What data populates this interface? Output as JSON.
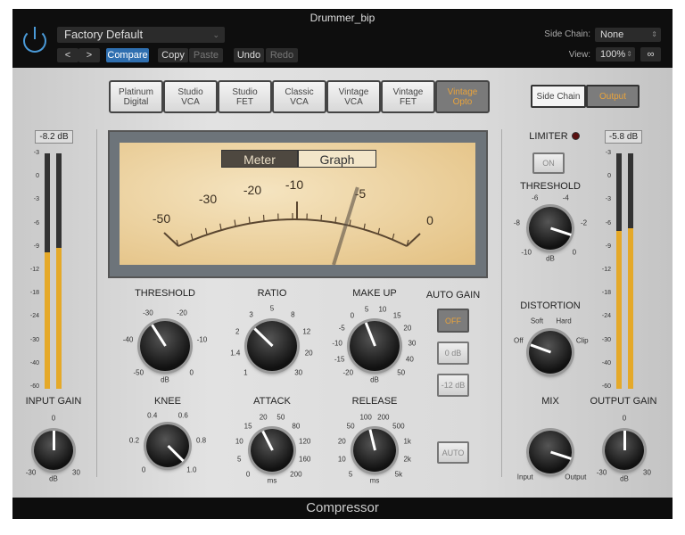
{
  "window": {
    "title": "Drummer_bip",
    "footer": "Compressor"
  },
  "header": {
    "preset": "Factory Default",
    "prev": "<",
    "next": ">",
    "compare": "Compare",
    "copy": "Copy",
    "paste": "Paste",
    "undo": "Undo",
    "redo": "Redo",
    "side_chain_label": "Side Chain:",
    "side_chain_value": "None",
    "view_label": "View:",
    "view_value": "100%"
  },
  "models": [
    {
      "label": "Platinum\nDigital"
    },
    {
      "label": "Studio\nVCA"
    },
    {
      "label": "Studio\nFET"
    },
    {
      "label": "Classic\nVCA"
    },
    {
      "label": "Vintage\nVCA"
    },
    {
      "label": "Vintage\nFET"
    },
    {
      "label": "Vintage\nOpto",
      "active": true
    }
  ],
  "side_toggle": {
    "side_chain": "Side Chain",
    "output": "Output",
    "active": "output"
  },
  "vu": {
    "tab_meter": "Meter",
    "tab_graph": "Graph",
    "active_tab": "meter",
    "scale": [
      "-50",
      "-30",
      "-20",
      "-10",
      "-5",
      "0"
    ],
    "needle_db": -5
  },
  "input": {
    "readout": "-8.2 dB",
    "label": "INPUT GAIN",
    "levels": [
      0.58,
      0.6
    ]
  },
  "output": {
    "readout": "-5.8 dB",
    "label": "OUTPUT GAIN",
    "levels": [
      0.67,
      0.68
    ]
  },
  "meter_scale": [
    "-3",
    "0",
    "-3",
    "-6",
    "-9",
    "-12",
    "-18",
    "-24",
    "-30",
    "-40",
    "-60"
  ],
  "auto_gain": {
    "label": "AUTO GAIN",
    "off": "OFF",
    "zero": "0 dB",
    "minus12": "-12 dB",
    "auto": "AUTO"
  },
  "limiter": {
    "label": "LIMITER",
    "on": "ON"
  },
  "knobs": {
    "threshold": {
      "label": "THRESHOLD",
      "unit": "dB",
      "scale": [
        "-50",
        "-40",
        "-30",
        "-20",
        "-10",
        "0"
      ],
      "position": 0.38
    },
    "ratio": {
      "label": "RATIO",
      "unit": "",
      "scale": [
        "1",
        "1.4",
        "2",
        "3",
        "5",
        "8",
        "12",
        "20",
        "30"
      ],
      "position": 0.33
    },
    "makeup": {
      "label": "MAKE UP",
      "unit": "dB",
      "scale": [
        "-20",
        "-15",
        "-10",
        "-5",
        "0",
        "5",
        "10",
        "15",
        "20",
        "30",
        "40",
        "50"
      ],
      "position": 0.42
    },
    "knee": {
      "label": "KNEE",
      "unit": "",
      "scale": [
        "0",
        "0.2",
        "0.4",
        "0.6",
        "0.8",
        "1.0"
      ],
      "position": 1.0
    },
    "attack": {
      "label": "ATTACK",
      "unit": "ms",
      "scale": [
        "0",
        "5",
        "10",
        "15",
        "20",
        "50",
        "80",
        "120",
        "160",
        "200"
      ],
      "position": 0.4
    },
    "release": {
      "label": "RELEASE",
      "unit": "ms",
      "scale": [
        "5",
        "10",
        "20",
        "50",
        "100",
        "200",
        "500",
        "1k",
        "2k",
        "5k"
      ],
      "position": 0.45
    },
    "lim_threshold": {
      "label": "THRESHOLD",
      "unit": "dB",
      "scale": [
        "-10",
        "-8",
        "-6",
        "-4",
        "-2",
        "0"
      ],
      "position": 0.9
    },
    "distortion": {
      "label": "DISTORTION",
      "unit": "",
      "scale": [
        "Off",
        "Soft",
        "Hard",
        "Clip"
      ],
      "position": 0.0
    },
    "mix": {
      "label": "MIX",
      "unit": "",
      "scale": [
        "Input",
        "Output"
      ],
      "position": 0.9
    },
    "output_gain": {
      "label": "",
      "unit": "dB",
      "scale": [
        "-30",
        "0",
        "30"
      ],
      "position": 0.5
    },
    "input_gain": {
      "label": "",
      "unit": "dB",
      "scale": [
        "-30",
        "0",
        "30"
      ],
      "position": 0.5
    }
  },
  "colors": {
    "accent": "#e5a929",
    "active_text": "#e8a33c",
    "compare_blue": "#2f6fb0"
  }
}
